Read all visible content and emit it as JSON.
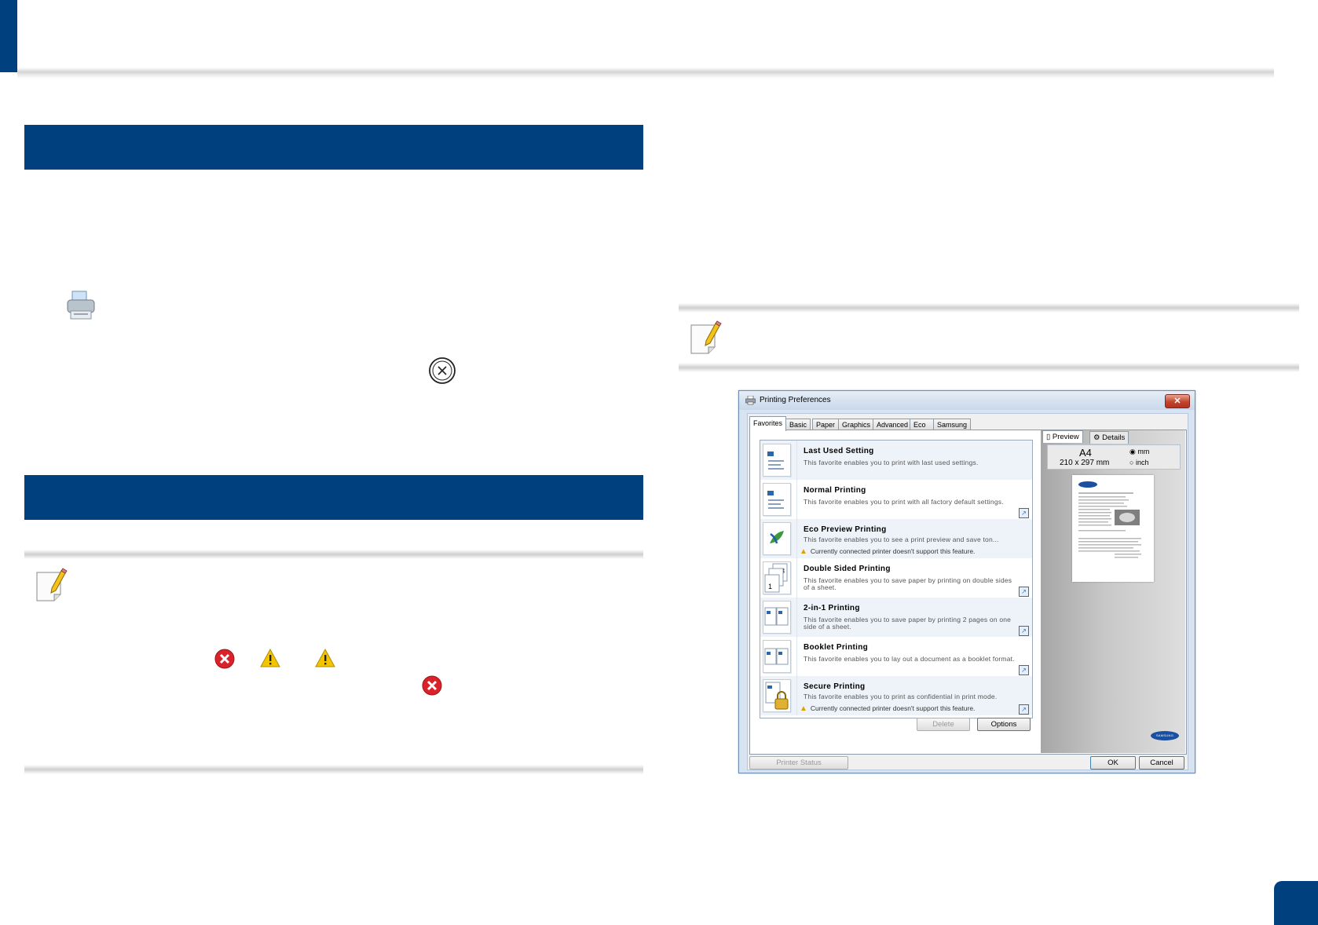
{
  "colors": {
    "accent": "#00407f",
    "warning": "#e6b800",
    "error": "#d9222a"
  },
  "page": {
    "page_number_badge": ""
  },
  "left_column": {
    "printer_icon": "printer-icon",
    "cancel_icon": "cancel-circle-icon",
    "note_icon": "note-pencil-icon",
    "status_icons": [
      "error-icon",
      "warning-icon",
      "warning-icon",
      "error-icon"
    ]
  },
  "right_column": {
    "note_icon": "note-pencil-icon"
  },
  "dialog": {
    "title": "Printing Preferences",
    "close_label": "✕",
    "tabs": [
      "Favorites",
      "Basic",
      "Paper",
      "Graphics",
      "Advanced",
      "Eco",
      "Samsung"
    ],
    "favorites": [
      {
        "title": "Last Used Setting",
        "desc": "This favorite enables you to print with last used settings.",
        "warning": "",
        "link": false
      },
      {
        "title": "Normal Printing",
        "desc": "This favorite enables you to print with all factory default settings.",
        "warning": "",
        "link": true
      },
      {
        "title": "Eco Preview Printing",
        "desc": "This favorite enables you to see a print preview and save ton...",
        "warning": "Currently connected printer doesn't support this feature.",
        "link": false
      },
      {
        "title": "Double Sided Printing",
        "desc": "This favorite enables you to save paper by printing on double sides of a sheet.",
        "warning": "",
        "link": true
      },
      {
        "title": "2-in-1 Printing",
        "desc": "This favorite enables you to save paper by printing 2 pages on one side of a sheet.",
        "warning": "",
        "link": true
      },
      {
        "title": "Booklet Printing",
        "desc": "This favorite enables you to lay out a document as a booklet format.",
        "warning": "",
        "link": true
      },
      {
        "title": "Secure Printing",
        "desc": "This favorite enables you to print as confidential in print mode.",
        "warning": "Currently connected printer doesn't support this feature.",
        "link": true
      }
    ],
    "delete_label": "Delete",
    "options_label": "Options",
    "preview_tab": "Preview",
    "details_tab": "Details",
    "paper_size": "A4",
    "paper_dims": "210 x 297 mm",
    "unit_mm": "mm",
    "unit_inch": "inch",
    "unit_selected": "mm",
    "brand_logo": "SAMSUNG",
    "printer_status_label": "Printer Status",
    "ok_label": "OK",
    "cancel_label": "Cancel"
  }
}
